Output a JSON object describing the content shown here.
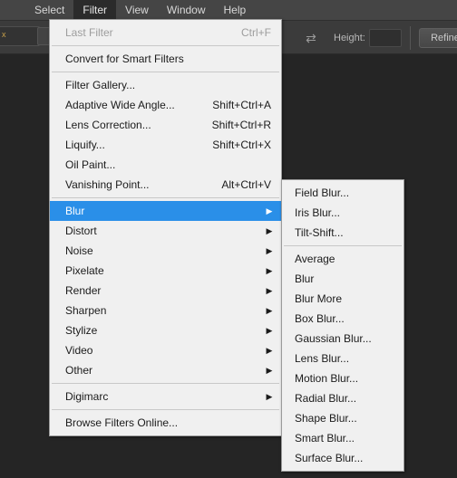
{
  "app": {
    "background_color": "#252525",
    "accent_color": "#2a8fe8",
    "menu_bg_color": "#f0f0f0"
  },
  "menubar": {
    "items": [
      {
        "label": "Select",
        "active": false
      },
      {
        "label": "Filter",
        "active": true
      },
      {
        "label": "View",
        "active": false
      },
      {
        "label": "Window",
        "active": false
      },
      {
        "label": "Help",
        "active": false
      }
    ]
  },
  "toolbar": {
    "x_icon": "x",
    "swap_icon": "swap-arrows-icon",
    "height_label": "Height:",
    "height_value": "",
    "refine_button_label": "Refine"
  },
  "filter_menu": {
    "title": "Filter",
    "groups": [
      {
        "items": [
          {
            "label": "Last Filter",
            "shortcut": "Ctrl+F",
            "disabled": true,
            "submenu": false
          }
        ]
      },
      {
        "items": [
          {
            "label": "Convert for Smart Filters",
            "shortcut": "",
            "disabled": false,
            "submenu": false
          }
        ]
      },
      {
        "items": [
          {
            "label": "Filter Gallery...",
            "shortcut": "",
            "disabled": false,
            "submenu": false
          },
          {
            "label": "Adaptive Wide Angle...",
            "shortcut": "Shift+Ctrl+A",
            "disabled": false,
            "submenu": false
          },
          {
            "label": "Lens Correction...",
            "shortcut": "Shift+Ctrl+R",
            "disabled": false,
            "submenu": false
          },
          {
            "label": "Liquify...",
            "shortcut": "Shift+Ctrl+X",
            "disabled": false,
            "submenu": false
          },
          {
            "label": "Oil Paint...",
            "shortcut": "",
            "disabled": false,
            "submenu": false
          },
          {
            "label": "Vanishing Point...",
            "shortcut": "Alt+Ctrl+V",
            "disabled": false,
            "submenu": false
          }
        ]
      },
      {
        "items": [
          {
            "label": "Blur",
            "shortcut": "",
            "disabled": false,
            "submenu": true,
            "highlighted": true
          },
          {
            "label": "Distort",
            "shortcut": "",
            "disabled": false,
            "submenu": true
          },
          {
            "label": "Noise",
            "shortcut": "",
            "disabled": false,
            "submenu": true
          },
          {
            "label": "Pixelate",
            "shortcut": "",
            "disabled": false,
            "submenu": true
          },
          {
            "label": "Render",
            "shortcut": "",
            "disabled": false,
            "submenu": true
          },
          {
            "label": "Sharpen",
            "shortcut": "",
            "disabled": false,
            "submenu": true
          },
          {
            "label": "Stylize",
            "shortcut": "",
            "disabled": false,
            "submenu": true
          },
          {
            "label": "Video",
            "shortcut": "",
            "disabled": false,
            "submenu": true
          },
          {
            "label": "Other",
            "shortcut": "",
            "disabled": false,
            "submenu": true
          }
        ]
      },
      {
        "items": [
          {
            "label": "Digimarc",
            "shortcut": "",
            "disabled": false,
            "submenu": true
          }
        ]
      },
      {
        "items": [
          {
            "label": "Browse Filters Online...",
            "shortcut": "",
            "disabled": false,
            "submenu": false
          }
        ]
      }
    ]
  },
  "blur_submenu": {
    "title": "Blur",
    "groups": [
      {
        "items": [
          {
            "label": "Field Blur...",
            "shortcut": "",
            "disabled": false,
            "submenu": false
          },
          {
            "label": "Iris Blur...",
            "shortcut": "",
            "disabled": false,
            "submenu": false
          },
          {
            "label": "Tilt-Shift...",
            "shortcut": "",
            "disabled": false,
            "submenu": false
          }
        ]
      },
      {
        "items": [
          {
            "label": "Average",
            "shortcut": "",
            "disabled": false,
            "submenu": false
          },
          {
            "label": "Blur",
            "shortcut": "",
            "disabled": false,
            "submenu": false
          },
          {
            "label": "Blur More",
            "shortcut": "",
            "disabled": false,
            "submenu": false
          },
          {
            "label": "Box Blur...",
            "shortcut": "",
            "disabled": false,
            "submenu": false
          },
          {
            "label": "Gaussian Blur...",
            "shortcut": "",
            "disabled": false,
            "submenu": false
          },
          {
            "label": "Lens Blur...",
            "shortcut": "",
            "disabled": false,
            "submenu": false
          },
          {
            "label": "Motion Blur...",
            "shortcut": "",
            "disabled": false,
            "submenu": false
          },
          {
            "label": "Radial Blur...",
            "shortcut": "",
            "disabled": false,
            "submenu": false
          },
          {
            "label": "Shape Blur...",
            "shortcut": "",
            "disabled": false,
            "submenu": false
          },
          {
            "label": "Smart Blur...",
            "shortcut": "",
            "disabled": false,
            "submenu": false
          },
          {
            "label": "Surface Blur...",
            "shortcut": "",
            "disabled": false,
            "submenu": false
          }
        ]
      }
    ]
  }
}
